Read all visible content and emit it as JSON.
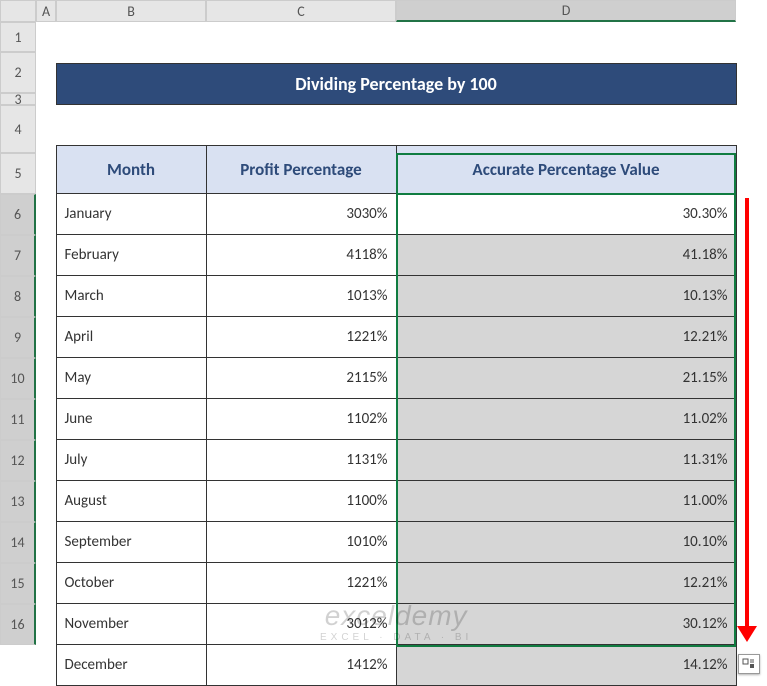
{
  "columns": [
    "A",
    "B",
    "C",
    "D"
  ],
  "title": "Dividing Percentage by 100",
  "headers": {
    "month": "Month",
    "profit": "Profit Percentage",
    "accurate": "Accurate Percentage Value"
  },
  "rows": [
    {
      "n": 5,
      "month": "January",
      "profit": "3030%",
      "accurate": "30.30%"
    },
    {
      "n": 6,
      "month": "February",
      "profit": "4118%",
      "accurate": "41.18%"
    },
    {
      "n": 7,
      "month": "March",
      "profit": "1013%",
      "accurate": "10.13%"
    },
    {
      "n": 8,
      "month": "April",
      "profit": "1221%",
      "accurate": "12.21%"
    },
    {
      "n": 9,
      "month": "May",
      "profit": "2115%",
      "accurate": "21.15%"
    },
    {
      "n": 10,
      "month": "June",
      "profit": "1102%",
      "accurate": "11.02%"
    },
    {
      "n": 11,
      "month": "July",
      "profit": "1131%",
      "accurate": "11.31%"
    },
    {
      "n": 12,
      "month": "August",
      "profit": "1100%",
      "accurate": "11.00%"
    },
    {
      "n": 13,
      "month": "September",
      "profit": "1010%",
      "accurate": "10.10%"
    },
    {
      "n": 14,
      "month": "October",
      "profit": "1221%",
      "accurate": "12.21%"
    },
    {
      "n": 15,
      "month": "November",
      "profit": "3012%",
      "accurate": "30.12%"
    },
    {
      "n": 16,
      "month": "December",
      "profit": "1412%",
      "accurate": "14.12%"
    }
  ],
  "watermark": {
    "line1": "exceldemy",
    "line2": "EXCEL · DATA · BI"
  },
  "chart_data": {
    "type": "table",
    "title": "Dividing Percentage by 100",
    "columns": [
      "Month",
      "Profit Percentage",
      "Accurate Percentage Value"
    ],
    "data": [
      [
        "January",
        "3030%",
        "30.30%"
      ],
      [
        "February",
        "4118%",
        "41.18%"
      ],
      [
        "March",
        "1013%",
        "10.13%"
      ],
      [
        "April",
        "1221%",
        "12.21%"
      ],
      [
        "May",
        "2115%",
        "21.15%"
      ],
      [
        "June",
        "1102%",
        "11.02%"
      ],
      [
        "July",
        "1131%",
        "11.31%"
      ],
      [
        "August",
        "1100%",
        "11.00%"
      ],
      [
        "September",
        "1010%",
        "10.10%"
      ],
      [
        "October",
        "1221%",
        "12.21%"
      ],
      [
        "November",
        "3012%",
        "30.12%"
      ],
      [
        "December",
        "1412%",
        "14.12%"
      ]
    ]
  }
}
